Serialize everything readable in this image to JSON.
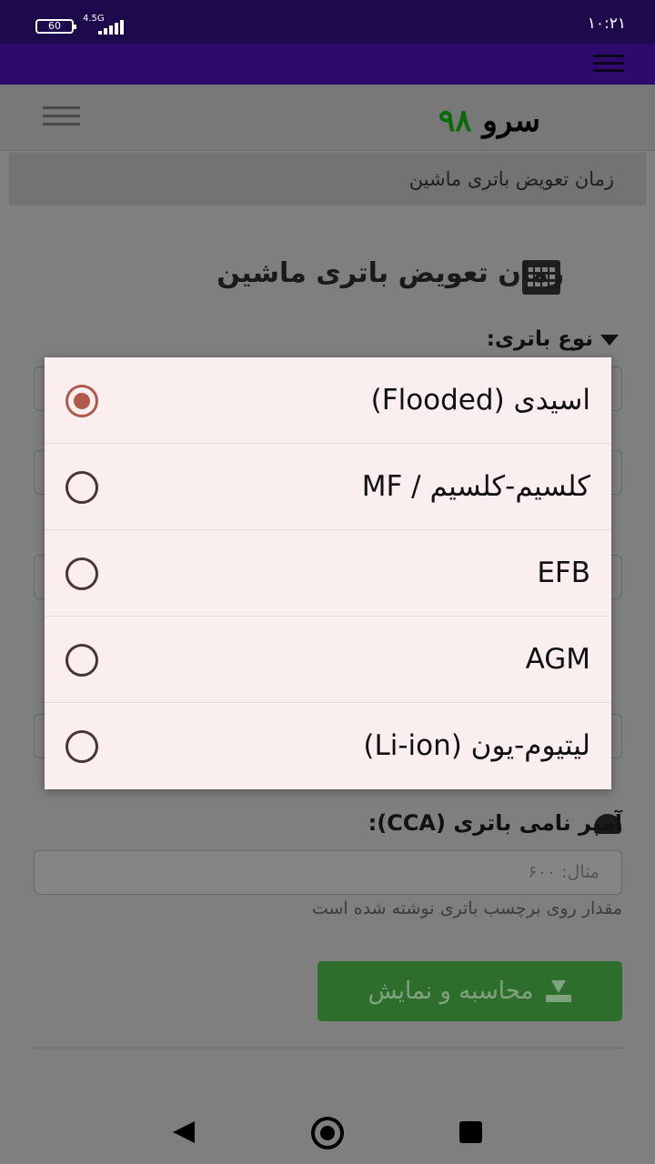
{
  "status_bar": {
    "battery": "60",
    "network": "4.5G",
    "time": "۱۰:۲۱"
  },
  "header": {
    "logo_word": "سرو",
    "logo_number": "۹۸"
  },
  "breadcrumb": "زمان تعویض باتری ماشین",
  "page": {
    "title": "زمان تعویض باتری ماشین",
    "battery_type_label": "نوع باتری:",
    "cca_label": "آمپر نامی باتری (CCA):",
    "cca_placeholder": "مثال: ۶۰۰",
    "cca_help": "مقدار روی برچسب باتری نوشته شده است",
    "submit_label": "محاسبه و نمایش"
  },
  "dialog": {
    "selected_index": 0,
    "options": [
      {
        "label": "اسیدی (Flooded)"
      },
      {
        "label": "کلسیم-کلسیم / MF"
      },
      {
        "label": "EFB"
      },
      {
        "label": "AGM"
      },
      {
        "label": "لیتیوم-یون (Li-ion)"
      }
    ]
  }
}
